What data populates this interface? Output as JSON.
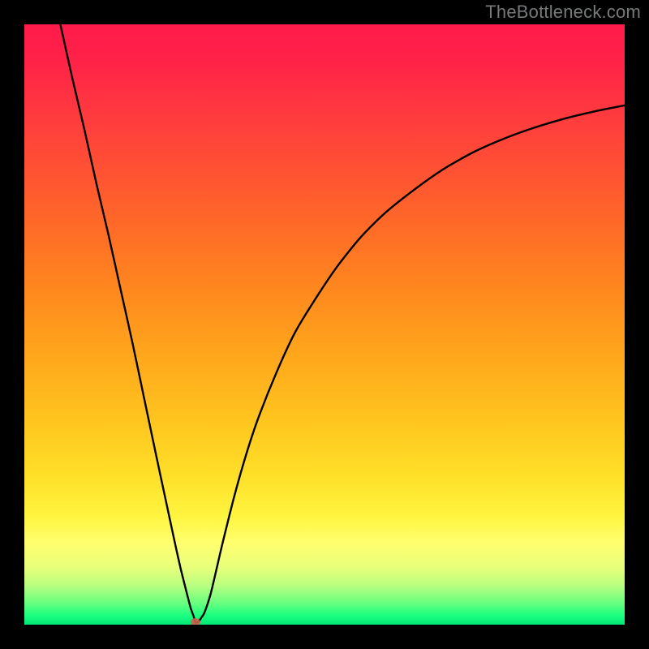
{
  "watermark": "TheBottleneck.com",
  "colors": {
    "black": "#000000",
    "curve": "#000000",
    "dot": "#d6604d",
    "watermark": "#77797a"
  },
  "gradient_stops": [
    {
      "offset": 0.0,
      "color": "#ff1a4a"
    },
    {
      "offset": 0.06,
      "color": "#ff2248"
    },
    {
      "offset": 0.15,
      "color": "#ff3a3f"
    },
    {
      "offset": 0.25,
      "color": "#ff5332"
    },
    {
      "offset": 0.35,
      "color": "#ff6e26"
    },
    {
      "offset": 0.45,
      "color": "#ff8a1e"
    },
    {
      "offset": 0.55,
      "color": "#ffa61c"
    },
    {
      "offset": 0.65,
      "color": "#ffc21e"
    },
    {
      "offset": 0.75,
      "color": "#ffdf28"
    },
    {
      "offset": 0.82,
      "color": "#fff540"
    },
    {
      "offset": 0.865,
      "color": "#ffff70"
    },
    {
      "offset": 0.905,
      "color": "#e8ff7a"
    },
    {
      "offset": 0.935,
      "color": "#b8ff80"
    },
    {
      "offset": 0.965,
      "color": "#66ff80"
    },
    {
      "offset": 0.985,
      "color": "#1aff80"
    },
    {
      "offset": 1.0,
      "color": "#02e676"
    }
  ],
  "chart_data": {
    "type": "line",
    "title": "",
    "xlabel": "",
    "ylabel": "",
    "xlim": [
      0,
      100
    ],
    "ylim": [
      0,
      100
    ],
    "series": [
      {
        "name": "bottleneck-curve",
        "x": [
          6,
          8,
          10,
          12,
          14,
          16,
          18,
          20,
          22,
          23.5,
          25,
          26,
          27,
          27.7,
          28.2,
          28.5,
          29,
          29.5,
          30,
          31,
          32,
          33,
          35,
          37,
          39,
          42,
          45,
          48,
          52,
          56,
          60,
          65,
          70,
          75,
          80,
          85,
          90,
          95,
          100
        ],
        "y": [
          100,
          91,
          82.5,
          73.5,
          65,
          56,
          47,
          37.5,
          28,
          21,
          14,
          9.5,
          5.5,
          2.8,
          1.4,
          0.4,
          0.5,
          1.2,
          2.0,
          5,
          9.2,
          13.5,
          21.5,
          28.5,
          34.5,
          42,
          48.5,
          53.5,
          59.5,
          64.5,
          68.5,
          72.5,
          76,
          78.8,
          81,
          82.8,
          84.3,
          85.5,
          86.5
        ]
      }
    ],
    "marker": {
      "x": 28.5,
      "y": 0.4
    }
  }
}
